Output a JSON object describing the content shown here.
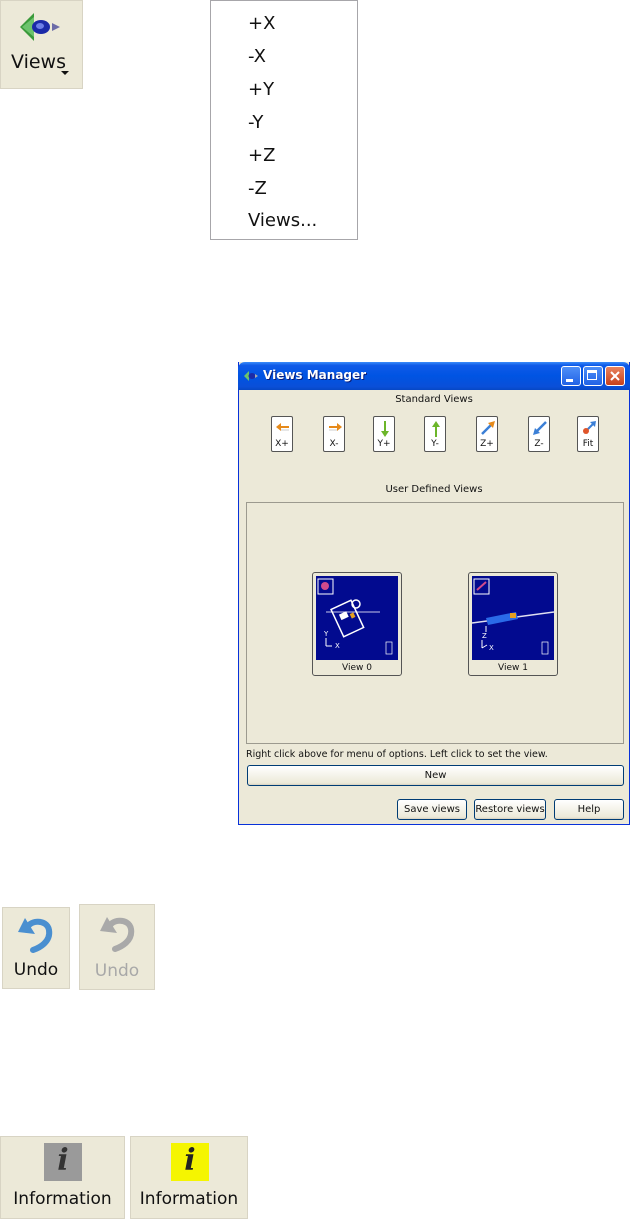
{
  "views_button": {
    "label": "Views",
    "icon": "eye-view-icon"
  },
  "views_menu": {
    "items": [
      "+X",
      "-X",
      "+Y",
      "-Y",
      "+Z",
      "-Z",
      "Views..."
    ]
  },
  "dialog": {
    "title": "Views Manager",
    "standard_views_label": "Standard Views",
    "standard_views": [
      {
        "label": "X+",
        "icon": "arrow-left-orange-icon"
      },
      {
        "label": "X-",
        "icon": "arrow-right-orange-icon"
      },
      {
        "label": "Y+",
        "icon": "arrow-down-green-icon"
      },
      {
        "label": "Y-",
        "icon": "arrow-up-green-icon"
      },
      {
        "label": "Z+",
        "icon": "arrow-diagonal-up-icon"
      },
      {
        "label": "Z-",
        "icon": "arrow-diagonal-down-icon"
      },
      {
        "label": "Fit",
        "icon": "fit-view-icon"
      }
    ],
    "user_views_label": "User Defined Views",
    "user_views": [
      {
        "label": "View 0"
      },
      {
        "label": "View 1"
      }
    ],
    "hint": "Right click above for menu of options.  Left click to set the view.",
    "new_button": "New",
    "save_button": "Save views",
    "restore_button": "Restore views",
    "help_button": "Help"
  },
  "undo_enabled": {
    "label": "Undo",
    "color": "#4a8fd0"
  },
  "undo_disabled": {
    "label": "Undo",
    "color": "#a9a9a9"
  },
  "info_off": {
    "label": "Information",
    "color": "#9a9a9a"
  },
  "info_on": {
    "label": "Information",
    "color": "#f5f500"
  }
}
